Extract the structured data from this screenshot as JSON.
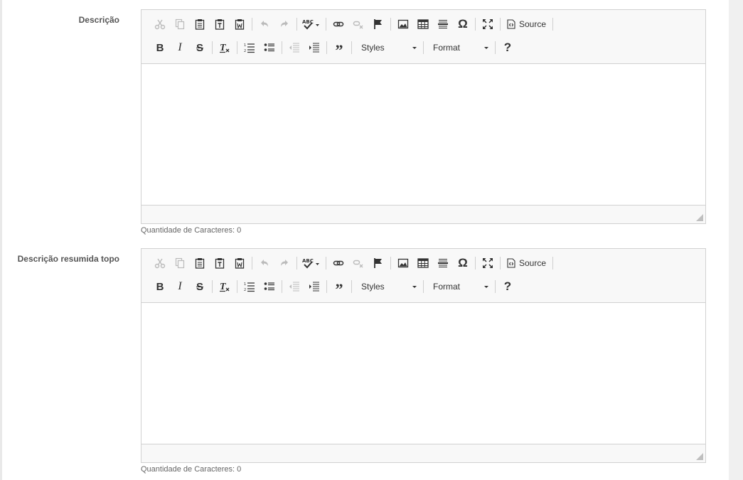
{
  "fields": [
    {
      "label": "Descrição",
      "counter": "Quantidade de Caracteres: 0",
      "toolbar": {
        "source_label": "Source",
        "styles_label": "Styles",
        "format_label": "Format",
        "help_label": "?"
      }
    },
    {
      "label": "Descrição resumida topo",
      "counter": "Quantidade de Caracteres: 0",
      "toolbar": {
        "source_label": "Source",
        "styles_label": "Styles",
        "format_label": "Format",
        "help_label": "?"
      }
    }
  ],
  "icons": {
    "row1": [
      "cut-icon",
      "copy-icon",
      "paste-icon",
      "paste-text-icon",
      "paste-word-icon",
      "undo-icon",
      "redo-icon",
      "spellcheck-icon",
      "link-icon",
      "unlink-icon",
      "anchor-icon",
      "image-icon",
      "table-icon",
      "horizontal-line-icon",
      "special-char-icon",
      "maximize-icon",
      "source-icon"
    ],
    "row2": [
      "bold-icon",
      "italic-icon",
      "strike-icon",
      "remove-format-icon",
      "numbered-list-icon",
      "bulleted-list-icon",
      "outdent-icon",
      "indent-icon",
      "blockquote-icon",
      "help-icon"
    ]
  },
  "colors": {
    "toolbar_bg": "#f8f8f8",
    "border": "#d1d1d1",
    "label": "#555555",
    "disabled_icon": "#bbbbbb"
  }
}
